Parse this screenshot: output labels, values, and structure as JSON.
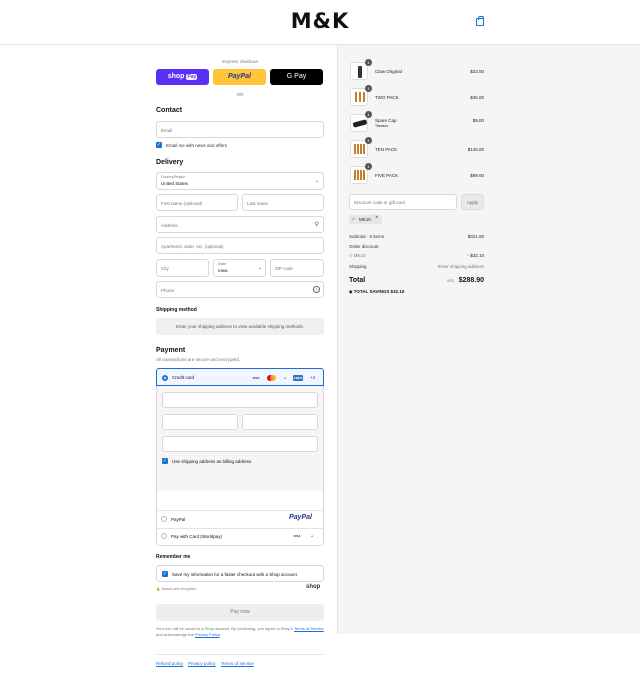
{
  "header": {
    "logo": "M&K",
    "cart_icon": "shopping-bag-icon"
  },
  "express": {
    "title": "Express checkout",
    "shop_pay": "shop",
    "shop_pay_badge": "Pay",
    "paypal": "PayPal",
    "gpay": "G Pay",
    "or": "OR"
  },
  "contact": {
    "heading": "Contact",
    "email_placeholder": "Email",
    "news_label": "Email me with news and offers"
  },
  "delivery": {
    "heading": "Delivery",
    "country_label": "Country/Region",
    "country_value": "United States",
    "first_name": "First name (optional)",
    "last_name": "Last name",
    "address": "Address",
    "apartment": "Apartment, suite, etc. (optional)",
    "city": "City",
    "state_label": "State",
    "state_value": "Iowa",
    "zip": "ZIP code",
    "phone": "Phone"
  },
  "shipping": {
    "heading": "Shipping method",
    "note": "Enter your shipping address to view available shipping methods."
  },
  "payment": {
    "heading": "Payment",
    "subtitle": "All transactions are secure and encrypted.",
    "credit_card": "Credit card",
    "more_cards": "+4",
    "billing_label": "Use shipping address as billing address",
    "paypal": "PayPal",
    "paypal_logo": "PayPal",
    "worldpay": "Pay with Card (Worldpay)",
    "card_brands": [
      "VISA",
      "MC",
      "AMEX"
    ]
  },
  "remember": {
    "heading": "Remember me",
    "save_label": "Save my information for a faster checkout with a Shop account",
    "secure": "Secure and encrypted",
    "shop_logo": "shop"
  },
  "pay_now": "Pay now",
  "terms": {
    "line1": "Your info will be saved to a Shop account. By continuing, you agree to Shop's",
    "tos": "Terms of Service",
    "and": " and acknowledge the ",
    "privacy": "Privacy Policy",
    "period": "."
  },
  "footer": {
    "refund": "Refund policy",
    "privacy": "Privacy policy",
    "terms": "Terms of service"
  },
  "cart": {
    "items": [
      {
        "name": "Claw Original",
        "sub": "",
        "qty": "1",
        "price": "$23.00"
      },
      {
        "name": "TWO PACK",
        "sub": "",
        "qty": "1",
        "price": "$45.00"
      },
      {
        "name": "Spare Cap",
        "sub": "Titanium",
        "qty": "1",
        "price": "$9.00"
      },
      {
        "name": "TEN PACK",
        "sub": "",
        "qty": "1",
        "price": "$145.00"
      },
      {
        "name": "FIVE PACK",
        "sub": "",
        "qty": "1",
        "price": "$99.00"
      }
    ],
    "discount_placeholder": "Discount code or gift card",
    "apply": "Apply",
    "code_tag": "MK10",
    "subtotal_label": "Subtotal · 5 items",
    "subtotal": "$321.00",
    "order_discount": "Order discount",
    "discount_code": "MK10",
    "discount_amount": "- $32.10",
    "shipping_label": "Shipping",
    "shipping_value": "Enter shipping address",
    "total_label": "Total",
    "currency": "USD",
    "total": "$288.90",
    "savings_label": "TOTAL SAVINGS",
    "savings": "$32.10"
  }
}
